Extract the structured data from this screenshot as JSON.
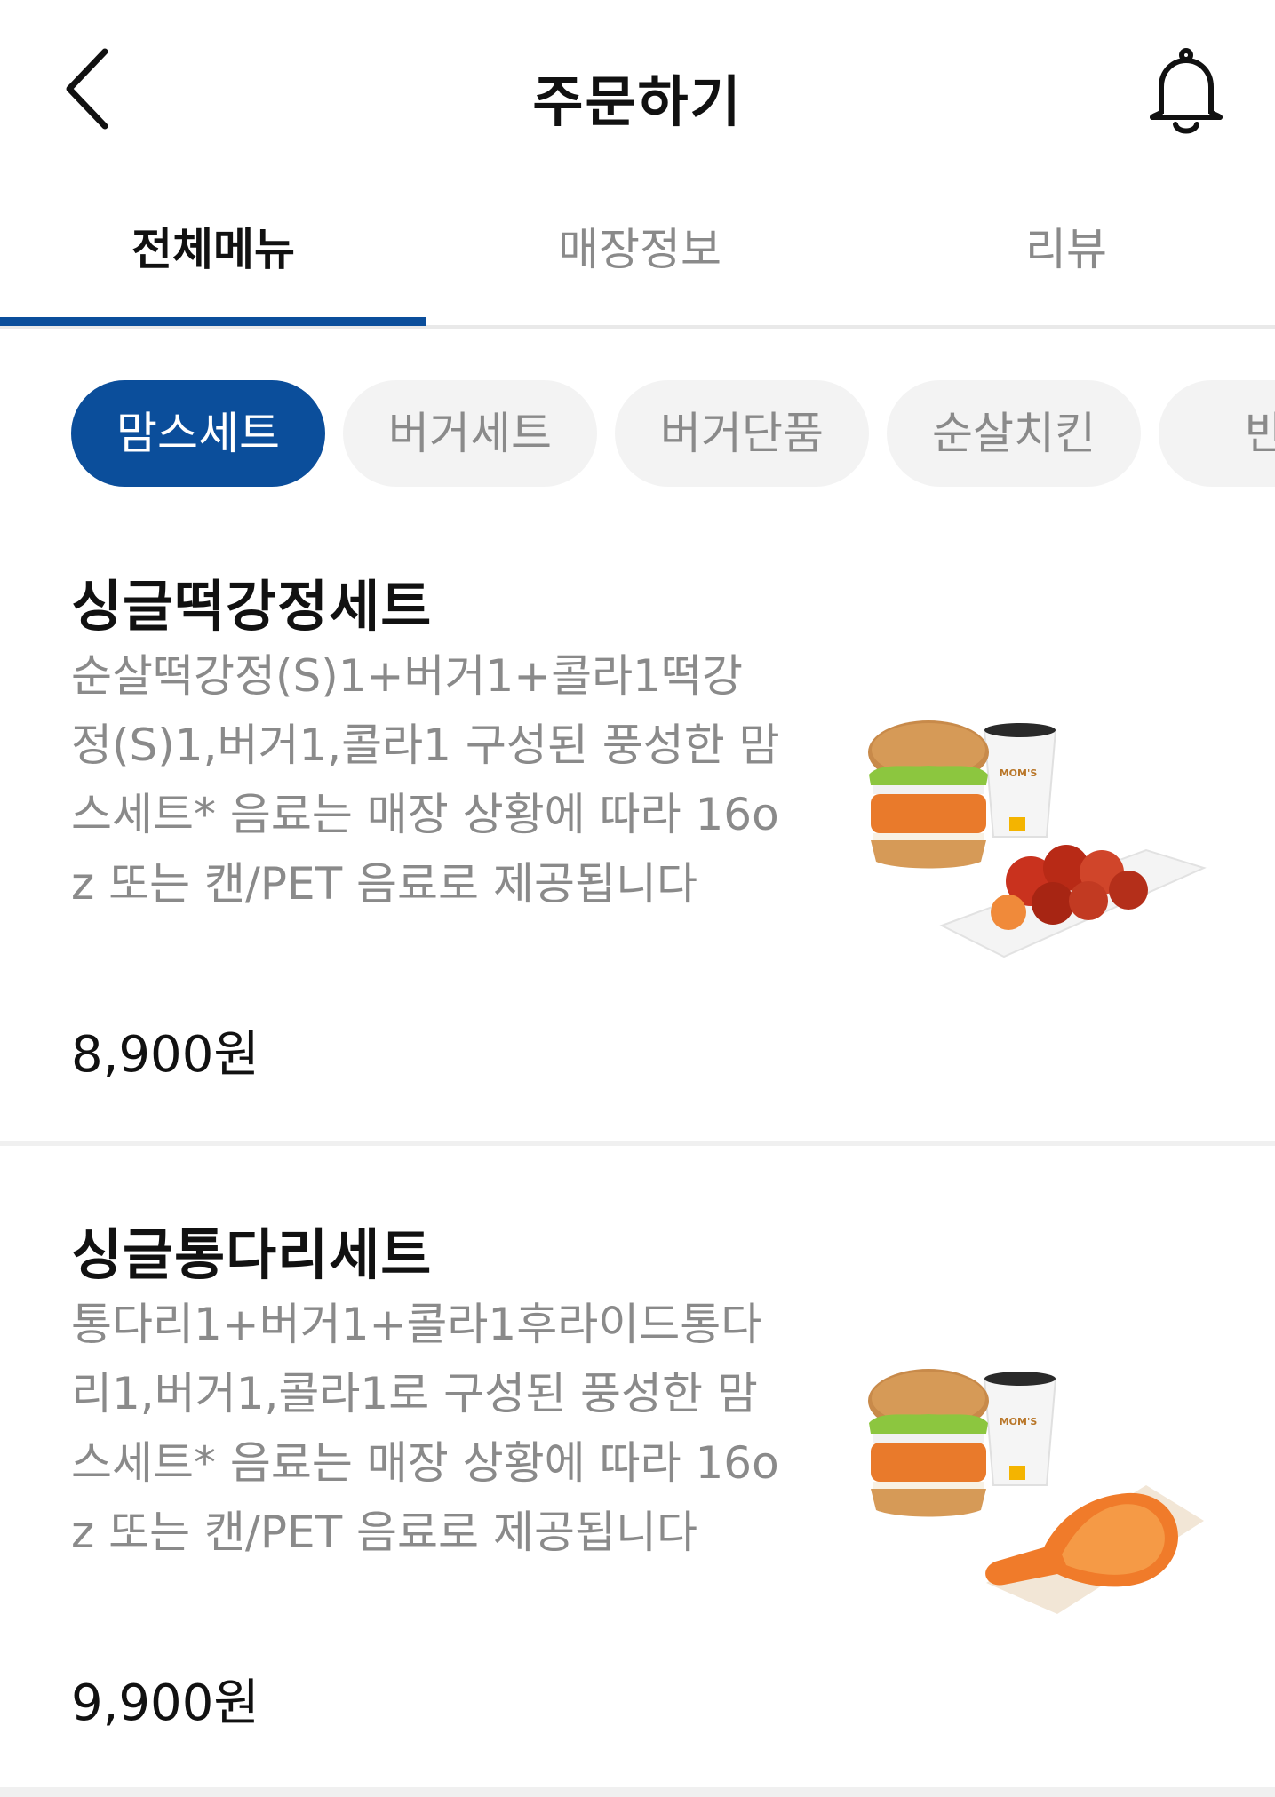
{
  "header": {
    "title": "주문하기",
    "back_icon": "chevron-left-icon",
    "bell_icon": "bell-icon"
  },
  "tabs": [
    {
      "label": "전체메뉴",
      "active": true
    },
    {
      "label": "매장정보",
      "active": false
    },
    {
      "label": "리뷰",
      "active": false
    }
  ],
  "categories": [
    {
      "label": "맘스세트",
      "active": true
    },
    {
      "label": "버거세트",
      "active": false
    },
    {
      "label": "버거단품",
      "active": false
    },
    {
      "label": "순살치킨",
      "active": false
    },
    {
      "label": "반마",
      "active": false
    }
  ],
  "menu_items": [
    {
      "name": "싱글떡강정세트",
      "description": "순살떡강정(S)1+버거1+콜라1떡강정(S)1,버거1,콜라1 구성된 풍성한 맘스세트* 음료는 매장 상황에 따라 16oz 또는 캔/PET 음료로 제공됩니다",
      "price": "8,900원",
      "cup_logo": "MOM'S"
    },
    {
      "name": "싱글통다리세트",
      "description": "통다리1+버거1+콜라1후라이드통다리1,버거1,콜라1로 구성된 풍성한 맘스세트* 음료는 매장 상황에 따라 16oz 또는 캔/PET 음료로 제공됩니다",
      "price": "9,900원",
      "cup_logo": "MOM'S"
    }
  ],
  "colors": {
    "accent": "#0b4e9b",
    "text_primary": "#111111",
    "text_secondary": "#8a8a8a",
    "chip_bg": "#f3f3f3"
  }
}
